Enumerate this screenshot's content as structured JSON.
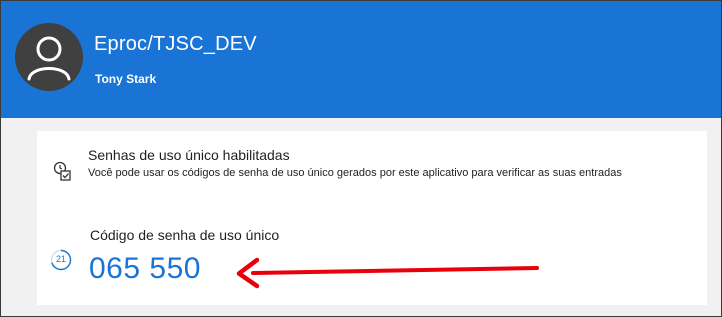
{
  "header": {
    "account_name": "Eproc/TJSC_DEV",
    "user_name": "Tony Stark",
    "avatar_icon": "person-icon",
    "background_color": "#1a74d6"
  },
  "status": {
    "icon": "otp-enabled-icon",
    "title": "Senhas de uso único habilitadas",
    "description": "Você pode usar os códigos de senha de uso único gerados por este aplicativo para verificar as suas entradas"
  },
  "otp": {
    "label": "Código de senha de uso único",
    "timer_seconds": "21",
    "timer_remaining_fraction": 0.7,
    "code": "065 550",
    "accent_color": "#1a74d6"
  },
  "annotation": {
    "arrow_icon": "red-arrow-left-icon",
    "arrow_color": "#e8000b"
  }
}
